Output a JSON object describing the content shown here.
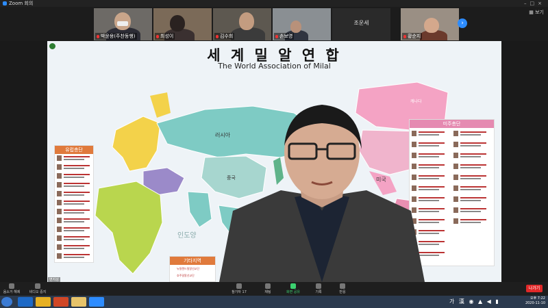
{
  "window": {
    "title": "Zoom 회의"
  },
  "participants": [
    {
      "name": "박윤용(주찬동행)"
    },
    {
      "name": "최성이"
    },
    {
      "name": "김수희"
    },
    {
      "name": "손보영"
    },
    {
      "name": "조운세"
    },
    {
      "name": "황순지"
    }
  ],
  "header": {
    "view_label": "보기"
  },
  "slide": {
    "title_kr": "세 계 밀 알 연 합",
    "title_en": "The World Association of Milal",
    "regions": {
      "russia": "러시아",
      "china": "중국",
      "indian_ocean": "인도양",
      "canada": "캐나다",
      "usa": "미국"
    },
    "panels": {
      "left_title": "유럽총단",
      "right_title": "미주총단",
      "bottom_title": "기타지역",
      "bottom_items": [
        "뉴질랜드밀알선교단",
        "호주밀알선교단"
      ]
    }
  },
  "presenter": {
    "name": "변지성"
  },
  "toolbar": {
    "mute_label": "음소거 해제",
    "video_label": "비디오 중지",
    "participants_label": "참가자",
    "participants_count": "17",
    "chat_label": "채팅",
    "share_label": "화면 공유",
    "record_label": "기록",
    "reactions_label": "반응",
    "end_label": "나가기"
  },
  "taskbar": {
    "tray_lang": "가 漢",
    "time": "오후 7:22",
    "date": "2020-11-10"
  },
  "colors": {
    "zoom_blue": "#2d8cff",
    "share_green": "#3bd16f",
    "end_red": "#e02828"
  }
}
